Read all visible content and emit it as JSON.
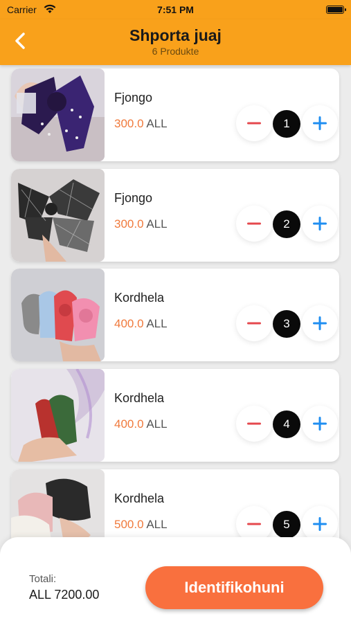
{
  "status_bar": {
    "carrier": "Carrier",
    "time": "7:51 PM"
  },
  "header": {
    "title": "Shporta juaj",
    "subtitle": "6 Produkte",
    "back_icon": "chevron-left-icon"
  },
  "colors": {
    "accent": "#f9a11b",
    "price": "#f07a3c",
    "minus": "#e5484d",
    "plus": "#1f8ef1",
    "button": "#f9703e"
  },
  "items": [
    {
      "name": "Fjongo",
      "price": "300.0",
      "currency": "ALL",
      "quantity": "1",
      "image": "purple-velvet-bow"
    },
    {
      "name": "Fjongo",
      "price": "300.0",
      "currency": "ALL",
      "quantity": "2",
      "image": "plaid-bows"
    },
    {
      "name": "Kordhela",
      "price": "400.0",
      "currency": "ALL",
      "quantity": "3",
      "image": "knotted-headbands"
    },
    {
      "name": "Kordhela",
      "price": "400.0",
      "currency": "ALL",
      "quantity": "4",
      "image": "red-green-headbands"
    },
    {
      "name": "Kordhela",
      "price": "500.0",
      "currency": "ALL",
      "quantity": "5",
      "image": "fur-headbands"
    }
  ],
  "footer": {
    "total_label": "Totali:",
    "total_value": "ALL 7200.00",
    "button_label": "Identifikohuni"
  }
}
